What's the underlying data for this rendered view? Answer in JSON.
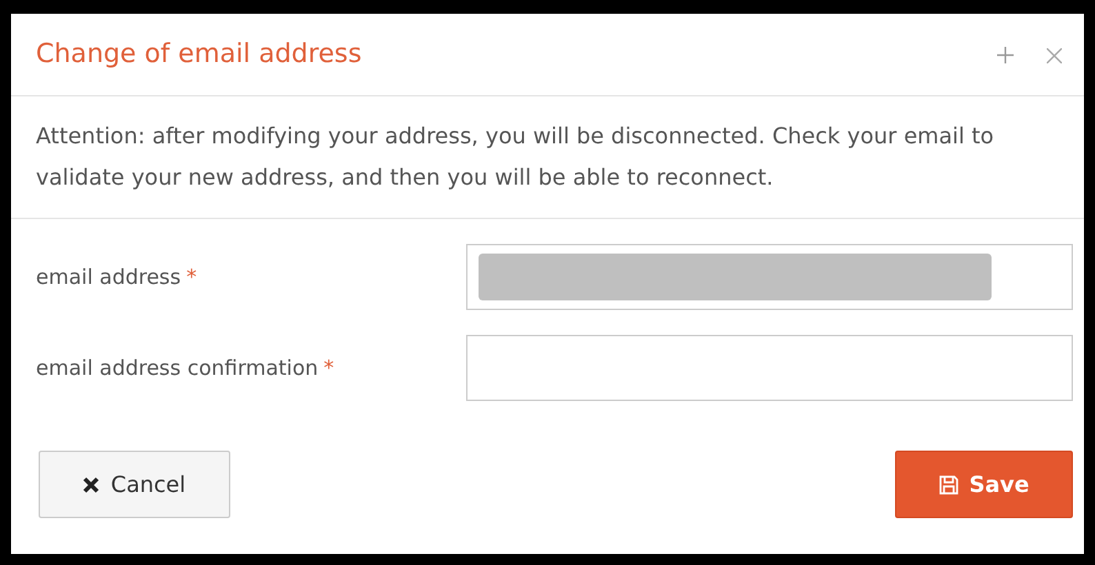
{
  "dialog": {
    "title": "Change of email address",
    "message": "Attention: after modifying your address, you will be disconnected. Check your email to validate your new address, and then you will be able to reconnect.",
    "fields": [
      {
        "label": "email address",
        "required_mark": "*",
        "redacted": true
      },
      {
        "label": "email address confirmation",
        "required_mark": "*",
        "redacted": false
      }
    ],
    "buttons": [
      {
        "label": "Cancel",
        "kind": "cancel"
      },
      {
        "label": "Save",
        "kind": "save"
      }
    ]
  }
}
